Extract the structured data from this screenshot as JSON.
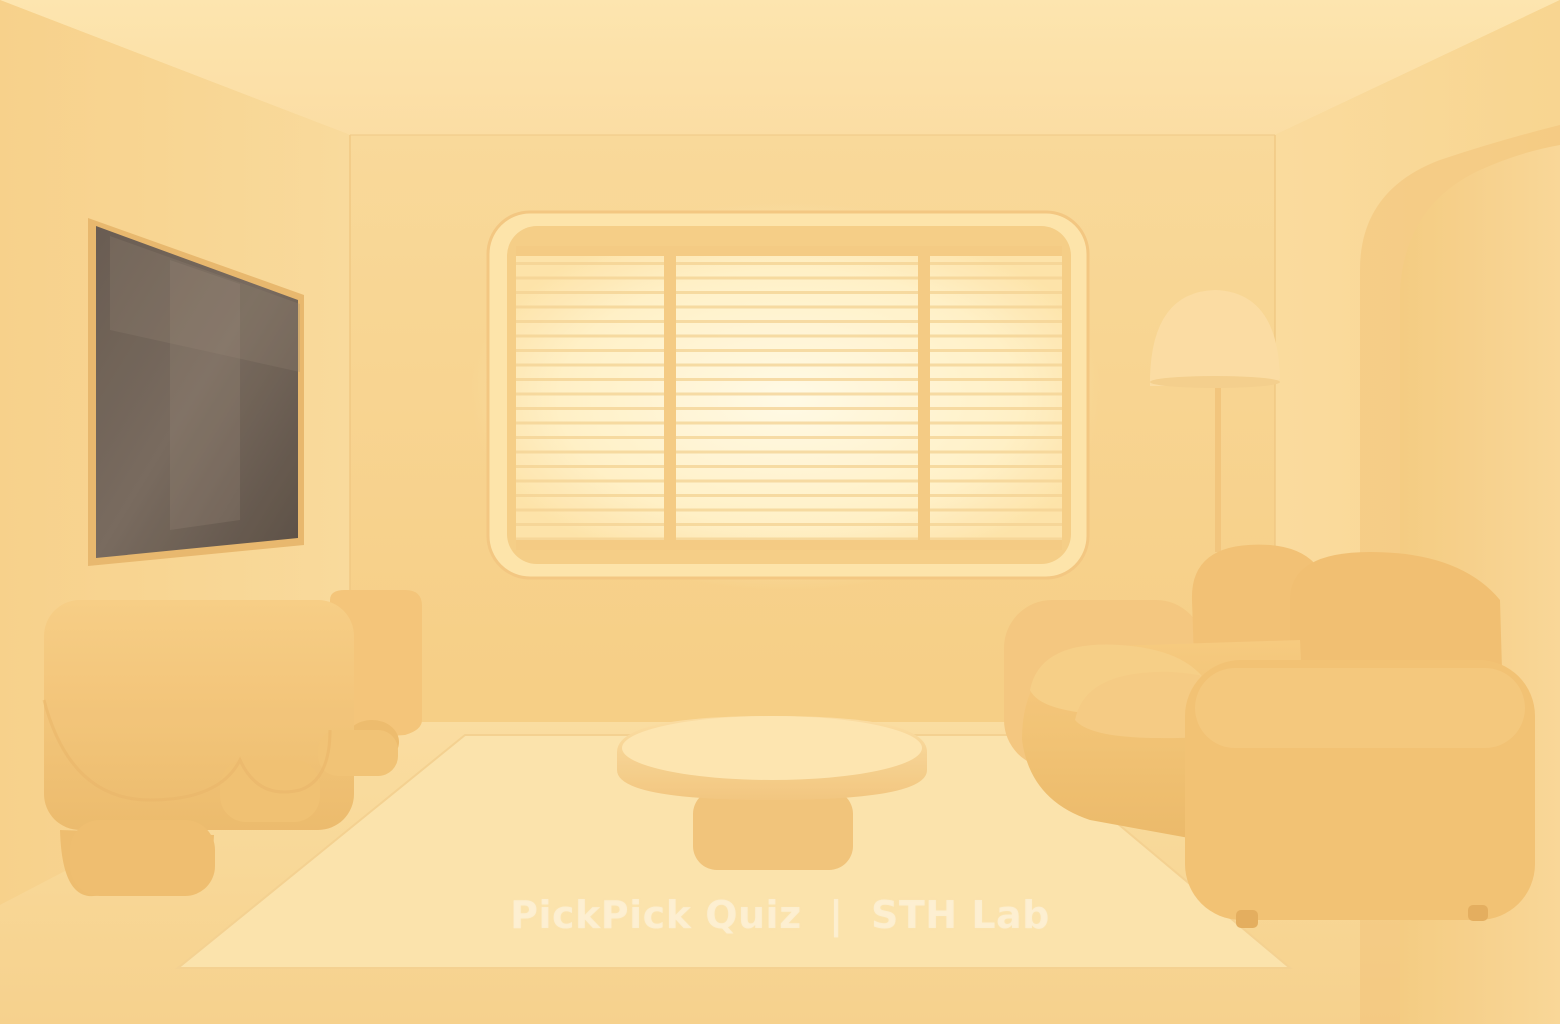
{
  "watermark": {
    "text": "PickPick Quiz  |  STH Lab"
  },
  "colors": {
    "wall": "#f8d48f",
    "ceiling": "#fbe0a4",
    "floor": "#f9da9c",
    "rug": "#fbe1a8",
    "furniture": "#f2c070",
    "window_glow": "#fff6d6"
  }
}
